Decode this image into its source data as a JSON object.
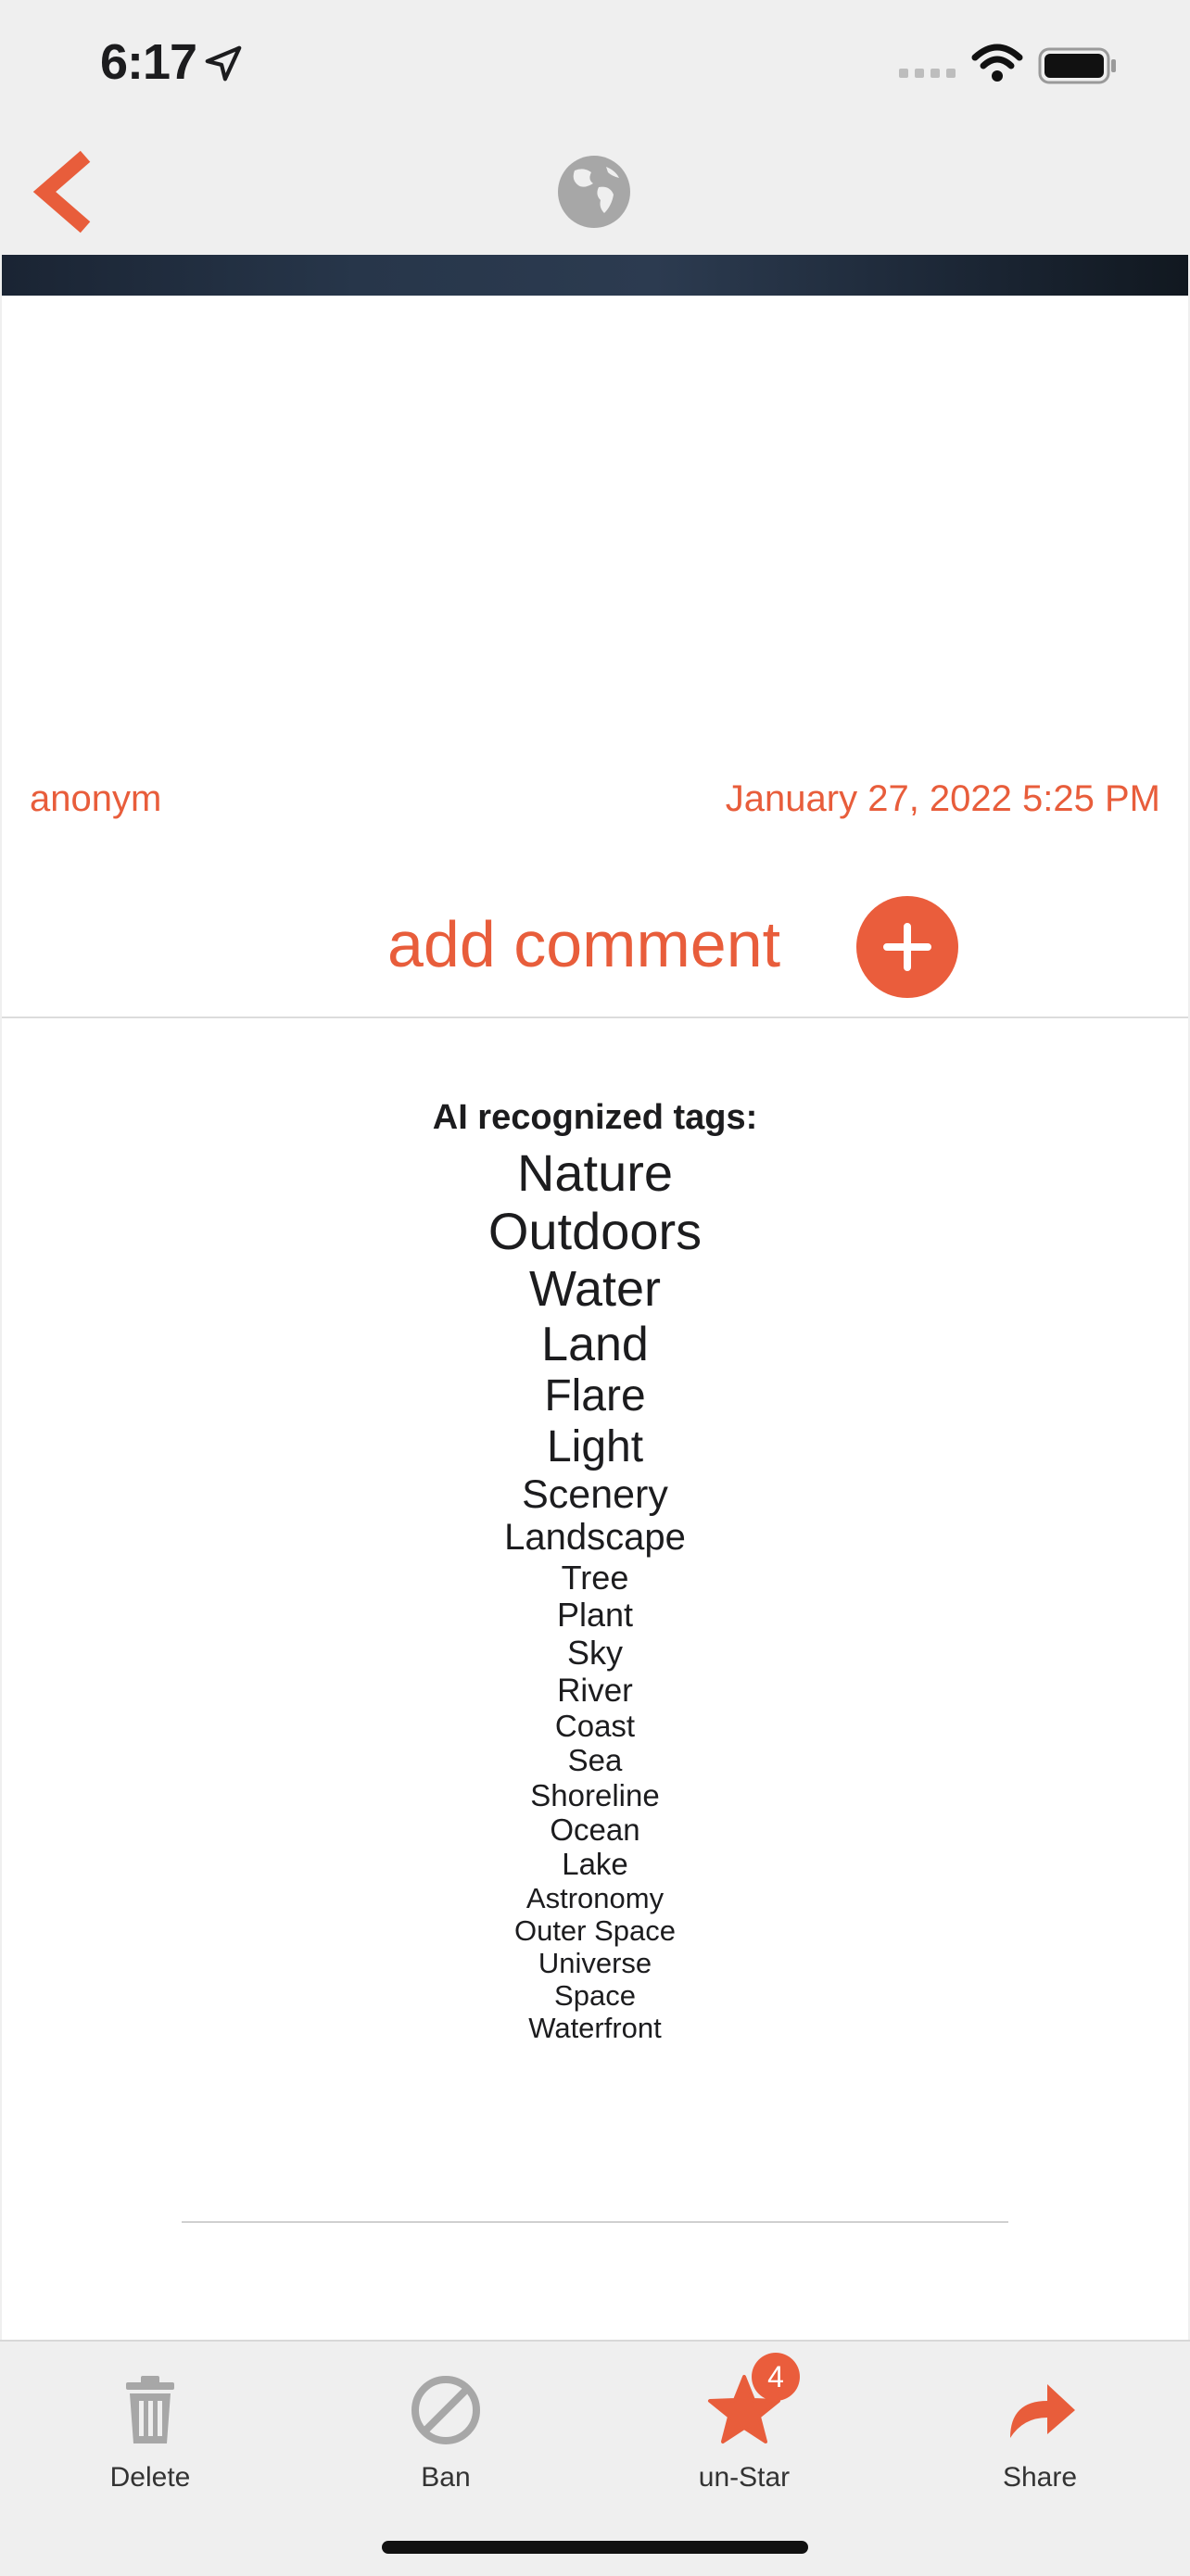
{
  "status_bar": {
    "time": "6:17"
  },
  "nav": {
    "back_icon": "chevron-left-icon",
    "center_icon": "globe-icon",
    "accent": "#e85d3b"
  },
  "post": {
    "author": "anonym",
    "date": "January 27, 2022 5:25 PM",
    "add_comment_label": "add comment"
  },
  "tags": {
    "title": "AI recognized tags:",
    "items": [
      "Nature",
      "Outdoors",
      "Water",
      "Land",
      "Flare",
      "Light",
      "Scenery",
      "Landscape",
      "Tree",
      "Plant",
      "Sky",
      "River",
      "Coast",
      "Sea",
      "Shoreline",
      "Ocean",
      "Lake",
      "Astronomy",
      "Outer Space",
      "Universe",
      "Space",
      "Waterfront"
    ]
  },
  "tab_bar": {
    "delete": {
      "label": "Delete",
      "icon": "trash-icon"
    },
    "ban": {
      "label": "Ban",
      "icon": "ban-icon"
    },
    "star": {
      "label": "un-Star",
      "icon": "star-icon",
      "badge": "4"
    },
    "share": {
      "label": "Share",
      "icon": "share-icon"
    }
  }
}
